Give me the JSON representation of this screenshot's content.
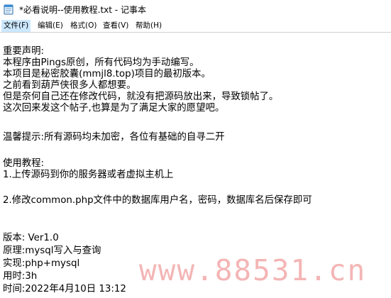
{
  "window": {
    "title": "*必看说明--使用教程.txt - 记事本",
    "icon": "notepad-icon"
  },
  "menu": [
    {
      "label": "文件(F)",
      "active": true
    },
    {
      "label": "编辑(E)",
      "active": false
    },
    {
      "label": "格式(O)",
      "active": false
    },
    {
      "label": "查看(V)",
      "active": false
    },
    {
      "label": "帮助(H)",
      "active": false
    }
  ],
  "document": {
    "lines": [
      "重要声明:",
      "本程序由Pings原创，所有代码均为手动编写。",
      "本项目是秘密胶囊(mmjl8.top)项目的最初版本。",
      "之前看到葫芦侠很多人都想要。",
      "但是奈何自己还在修改代码，就没有把源码放出来，导致锁帖了。",
      "这次回来发这个帖子,也算是为了满足大家的愿望吧。",
      "温馨提示:所有源码均未加密，各位有基础的自寻二开",
      "使用教程:",
      "1.上传源码到你的服务器或者虚拟主机上",
      "2.修改common.php文件中的数据库用户名，密码，数据库名后保存即可",
      "版本: Ver1.0",
      "原理:mysql写入与查询",
      "实现:php+mysql",
      "用时:3h",
      "时间:2022年4月10日 13:12"
    ]
  },
  "watermark": {
    "text": "www.88531.cn"
  }
}
